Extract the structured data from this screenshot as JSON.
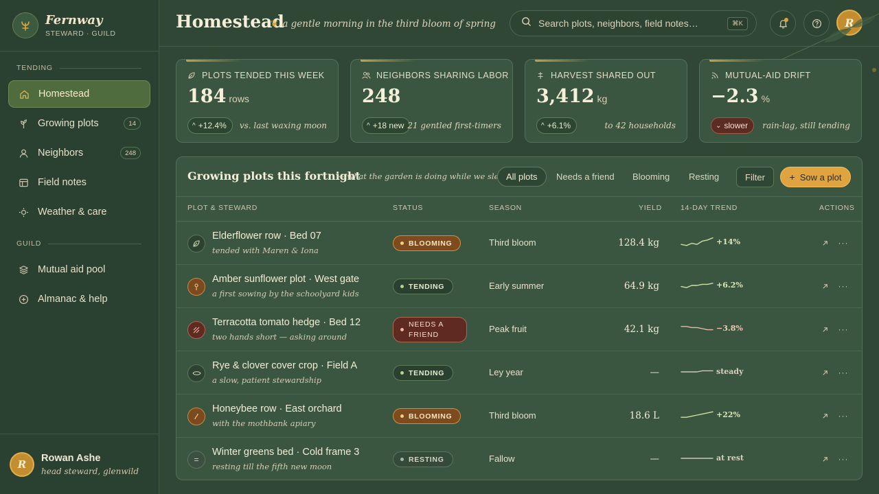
{
  "brand": {
    "name": "Fernway",
    "subtitle": "STEWARD · GUILD"
  },
  "sidebar": {
    "sections": [
      {
        "label": "TENDING"
      },
      {
        "label": "GUILD"
      }
    ],
    "items": [
      {
        "label": "Homestead",
        "icon": "home-icon",
        "active": true
      },
      {
        "label": "Growing plots",
        "icon": "sprout-icon",
        "count": "14"
      },
      {
        "label": "Neighbors",
        "icon": "person-icon",
        "count": "248"
      },
      {
        "label": "Field notes",
        "icon": "notebook-icon"
      },
      {
        "label": "Weather & care",
        "icon": "sun-icon"
      },
      {
        "label": "Mutual aid pool",
        "icon": "layers-icon"
      },
      {
        "label": "Almanac & help",
        "icon": "plus-circle-icon"
      }
    ]
  },
  "user": {
    "initial": "R",
    "name": "Rowan Ashe",
    "role": "head steward, glenwild"
  },
  "header": {
    "title": "Homestead",
    "tagline": "a gentle morning in the third bloom of spring",
    "search_placeholder": "Search plots, neighbors, field notes…",
    "shortcut": "⌘K",
    "avatar_initial": "R"
  },
  "stats": [
    {
      "label": "PLOTS TENDED THIS WEEK",
      "icon": "leaf-icon",
      "value": "184",
      "unit": "rows",
      "delta": "+12.4%",
      "direction": "up",
      "note": "vs. last waxing moon"
    },
    {
      "label": "NEIGHBORS SHARING LABOR",
      "icon": "people-icon",
      "value": "248",
      "unit": "",
      "delta": "+18 new",
      "direction": "up",
      "note": "21 gentled first-timers"
    },
    {
      "label": "HARVEST SHARED OUT",
      "icon": "balance-icon",
      "value": "3,412",
      "unit": "kg",
      "delta": "+6.1%",
      "direction": "up",
      "note": "to 42 households"
    },
    {
      "label": "MUTUAL-AID DRIFT",
      "icon": "signal-icon",
      "value": "−2.3",
      "unit": "%",
      "delta": "slower",
      "direction": "down",
      "note": "rain-lag, still tending"
    }
  ],
  "table": {
    "title": "Growing plots this fortnight",
    "subtitle": "— what the garden is doing while we sleep",
    "tabs": [
      "All plots",
      "Needs a friend",
      "Blooming",
      "Resting"
    ],
    "filter_label": "Filter",
    "sow_label": "Sow a plot",
    "columns": [
      "PLOT & STEWARD",
      "STATUS",
      "SEASON",
      "YIELD",
      "14-DAY TREND",
      "ACTIONS"
    ],
    "rows": [
      {
        "name": "Elderflower row · Bed 07",
        "sub": "tended with Maren & Iona",
        "icon": "leaf-icon",
        "tone": "green",
        "status": "BLOOMING",
        "status_kind": "blooming",
        "season": "Third bloom",
        "yield": "128.4 kg",
        "trend_label": "+14%",
        "trend": [
          3,
          2,
          4,
          3,
          6,
          7,
          9
        ]
      },
      {
        "name": "Amber sunflower plot · West gate",
        "sub": "a first sowing by the schoolyard kids",
        "icon": "sunflower-icon",
        "tone": "amber",
        "status": "TENDING",
        "status_kind": "tending",
        "season": "Early summer",
        "yield": "64.9 kg",
        "trend_label": "+6.2%",
        "trend": [
          4,
          3,
          5,
          5,
          6,
          6,
          7
        ]
      },
      {
        "name": "Terracotta tomato hedge · Bed 12",
        "sub": "two hands short — asking around",
        "icon": "slash-icon",
        "tone": "red",
        "status": "NEEDS A FRIEND",
        "status_kind": "needs",
        "season": "Peak fruit",
        "yield": "42.1 kg",
        "trend_label": "−3.8%",
        "trend": [
          7,
          7,
          6,
          6,
          5,
          4,
          4
        ]
      },
      {
        "name": "Rye & clover cover crop · Field A",
        "sub": "a slow, patient stewardship",
        "icon": "eye-icon",
        "tone": "green",
        "status": "TENDING",
        "status_kind": "tending",
        "season": "Ley year",
        "yield": "—",
        "trend_label": "steady",
        "trend": [
          5,
          5,
          5,
          5,
          6,
          6,
          6
        ]
      },
      {
        "name": "Honeybee row · East orchard",
        "sub": "with the mothbank apiary",
        "icon": "bee-icon",
        "tone": "amber",
        "status": "BLOOMING",
        "status_kind": "blooming",
        "season": "Third bloom",
        "yield": "18.6 L",
        "trend_label": "+22%",
        "trend": [
          3,
          3,
          4,
          5,
          6,
          7,
          8
        ]
      },
      {
        "name": "Winter greens bed · Cold frame 3",
        "sub": "resting till the fifth new moon",
        "icon": "rest-icon",
        "tone": "grey",
        "status": "RESTING",
        "status_kind": "resting",
        "season": "Fallow",
        "yield": "—",
        "trend_label": "at rest",
        "trend": [
          5,
          5,
          5,
          5,
          5,
          5,
          5
        ]
      }
    ]
  }
}
